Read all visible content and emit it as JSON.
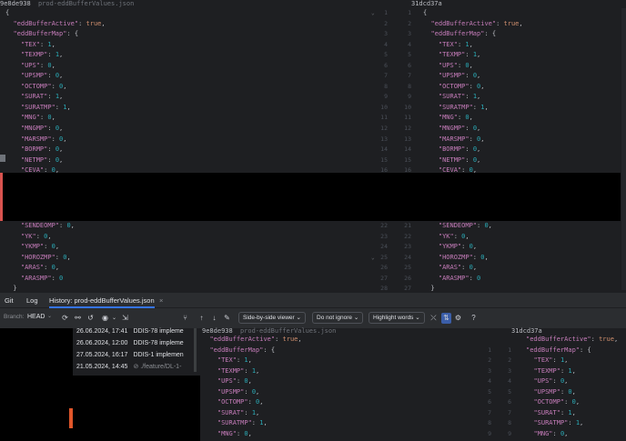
{
  "top_left_header": {
    "hash": "9e8de938",
    "file": "prod-eddBufferValues.json"
  },
  "top_right_header": {
    "hash": "31dcd37a"
  },
  "code_lines_top": [
    {
      "t": "{"
    },
    {
      "t": "  \"eddBufferActive\": true,"
    },
    {
      "t": "  \"eddBufferMap\": {"
    },
    {
      "t": "    \"TEX\": 1,"
    },
    {
      "t": "    \"TEXMP\": 1,"
    },
    {
      "t": "    \"UPS\": 0,"
    },
    {
      "t": "    \"UPSMP\": 0,"
    },
    {
      "t": "    \"OCTOMP\": 0,"
    },
    {
      "t": "    \"SURAT\": 1,"
    },
    {
      "t": "    \"SURATMP\": 1,"
    },
    {
      "t": "    \"MNG\": 0,"
    },
    {
      "t": "    \"MNGMP\": 0,"
    },
    {
      "t": "    \"MARSMP\": 0,"
    },
    {
      "t": "    \"BORMP\": 0,"
    },
    {
      "t": "    \"NETMP\": 0,"
    },
    {
      "t": "    \"CEVA\": 0,"
    }
  ],
  "code_lines_bottom": [
    {
      "t": "    \"SENDEOMP\": 0,"
    },
    {
      "t": "    \"YK\": 0,"
    },
    {
      "t": "    \"YKMP\": 0,"
    },
    {
      "t": "    \"HOROZMP\": 0,"
    },
    {
      "t": "    \"ARAS\": 0,"
    },
    {
      "t": "    \"ARASMP\": 0"
    },
    {
      "t": "  }"
    }
  ],
  "gutter_top_left": [
    "1",
    "2",
    "3",
    "4",
    "5",
    "6",
    "7",
    "8",
    "9",
    "10",
    "11",
    "12",
    "13",
    "14",
    "15",
    "16"
  ],
  "gutter_top_right": [
    "1",
    "2",
    "3",
    "4",
    "5",
    "6",
    "7",
    "8",
    "9",
    "10",
    "11",
    "12",
    "13",
    "14",
    "15",
    "16"
  ],
  "gutter_bottom_left": [
    "22",
    "23",
    "24",
    "25",
    "26",
    "27",
    "28"
  ],
  "gutter_bottom_right": [
    "21",
    "22",
    "23",
    "24",
    "25",
    "26",
    "27"
  ],
  "tabs": {
    "git": "Git",
    "log": "Log",
    "history": "History: prod-eddBufferValues.json"
  },
  "branch": {
    "label": "Branch:",
    "value": "HEAD"
  },
  "toolbar": {
    "viewer": "Side-by-side viewer",
    "ignore": "Do not ignore",
    "highlight": "Highlight words",
    "help": "?"
  },
  "commits": [
    {
      "date": "26.06.2024, 17:41",
      "msg": "DDIS-78 impleme"
    },
    {
      "date": "26.06.2024, 12:00",
      "msg": "DDIS-78 impleme"
    },
    {
      "date": "27.05.2024, 16:17",
      "msg": "DDIS-1 implemen"
    },
    {
      "date": "21.05.2024, 14:45",
      "msg": "⊘ ./feature/DL-1-"
    }
  ],
  "bottom_left_header": {
    "hash": "9e8de938",
    "file": "prod-eddBufferValues.json"
  },
  "bottom_right_header": {
    "hash": "31dcd37a"
  },
  "bottom_code": [
    "  \"eddBufferActive\": true,",
    "  \"eddBufferMap\": {",
    "    \"TEX\": 1,",
    "    \"TEXMP\": 1,",
    "    \"UPS\": 0,",
    "    \"UPSMP\": 0,",
    "    \"OCTOMP\": 0,",
    "    \"SURAT\": 1,",
    "    \"SURATMP\": 1,",
    "    \"MNG\": 0,"
  ],
  "bottom_gutter_a": [
    "",
    "1",
    "2",
    "3",
    "4",
    "5",
    "6",
    "7",
    "8",
    "9"
  ],
  "bottom_gutter_b": [
    "",
    "1",
    "2",
    "3",
    "4",
    "5",
    "6",
    "7",
    "8",
    "9",
    "10",
    "11"
  ],
  "colors": {
    "key": "#c77dbb",
    "number": "#2aacb8",
    "keyword": "#cf8e6d",
    "bg": "#1e1f22",
    "panel": "#2b2d30",
    "accent": "#3574f0"
  }
}
